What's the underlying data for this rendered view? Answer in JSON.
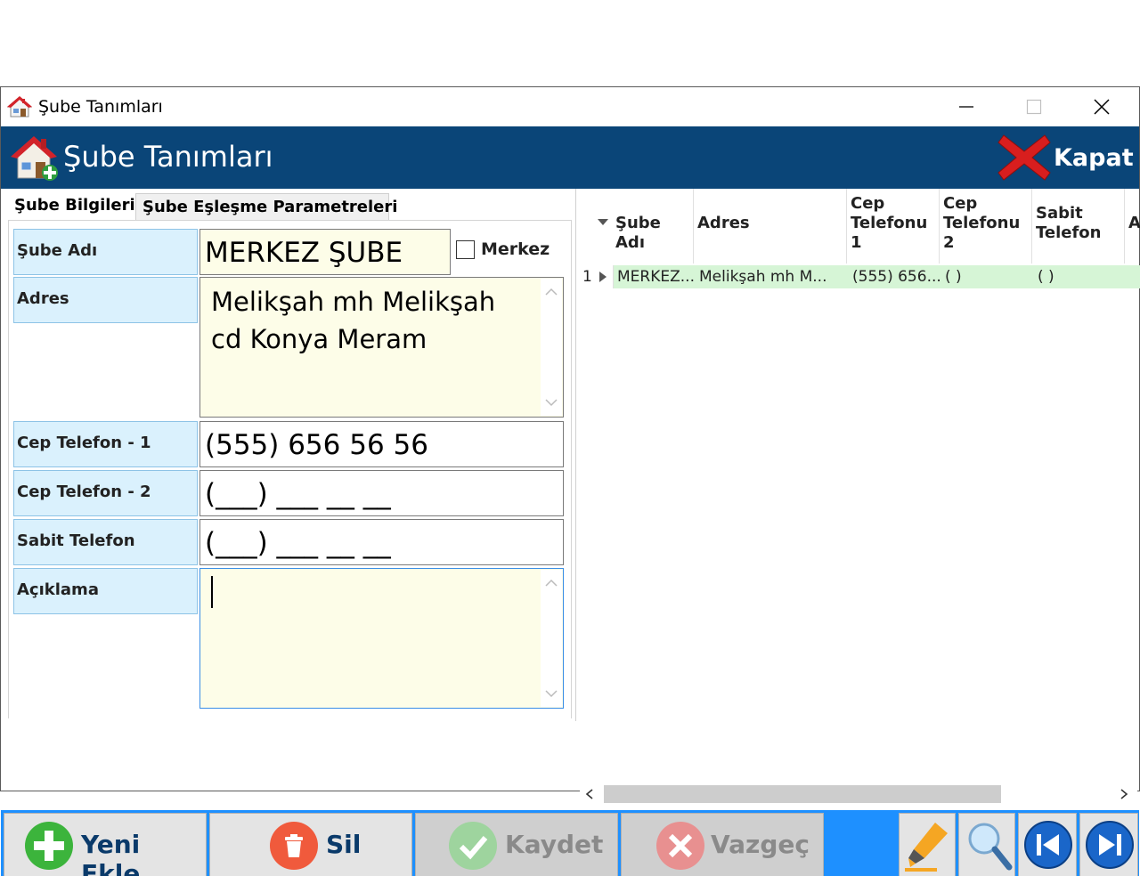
{
  "window": {
    "title": "Şube Tanımları"
  },
  "header": {
    "title": "Şube Tanımları",
    "close_label": "Kapat"
  },
  "tabs": [
    {
      "label": "Şube Bilgileri",
      "active": true
    },
    {
      "label": "Şube Eşleşme Parametreleri",
      "active": false
    }
  ],
  "form": {
    "sube_adi": {
      "label": "Şube Adı",
      "value": "MERKEZ ŞUBE"
    },
    "merkez": {
      "label": "Merkez",
      "checked": false
    },
    "adres": {
      "label": "Adres",
      "line1": "Melikşah mh Melikşah",
      "line2": "cd Konya Meram"
    },
    "cep1": {
      "label": "Cep Telefon - 1",
      "value": "(555) 656 56 56"
    },
    "cep2": {
      "label": "Cep Telefon - 2",
      "value": "(___) ___ __ __"
    },
    "sabit": {
      "label": "Sabit Telefon",
      "value": "(___) ___ __ __"
    },
    "aciklama": {
      "label": "Açıklama",
      "value": ""
    }
  },
  "grid": {
    "columns": [
      {
        "line1": "Şube Adı",
        "line2": "",
        "line3": ""
      },
      {
        "line1": "Adres",
        "line2": "",
        "line3": ""
      },
      {
        "line1": "Cep",
        "line2": "Telefonu",
        "line3": "1"
      },
      {
        "line1": "Cep",
        "line2": "Telefonu",
        "line3": "2"
      },
      {
        "line1": "Sabit",
        "line2": "Telefon",
        "line3": ""
      },
      {
        "line1": "A",
        "line2": "",
        "line3": ""
      }
    ],
    "rows": [
      {
        "num": "1",
        "sube": "MERKEZ...",
        "adres": "Melikşah mh M...",
        "cep1": "(555) 656...",
        "cep2": "(  )",
        "sabit": "(  )"
      }
    ]
  },
  "toolbar": {
    "new_label": "Yeni Ekle",
    "delete_label": "Sil",
    "save_label": "Kaydet",
    "cancel_label": "Vazgeç"
  },
  "colors": {
    "header_bg": "#0a4578",
    "label_bg": "#daf1fd",
    "input_yellow": "#fdfde8",
    "selected_row": "#d6f5d6",
    "toolbar_bg": "#1e90ff"
  }
}
